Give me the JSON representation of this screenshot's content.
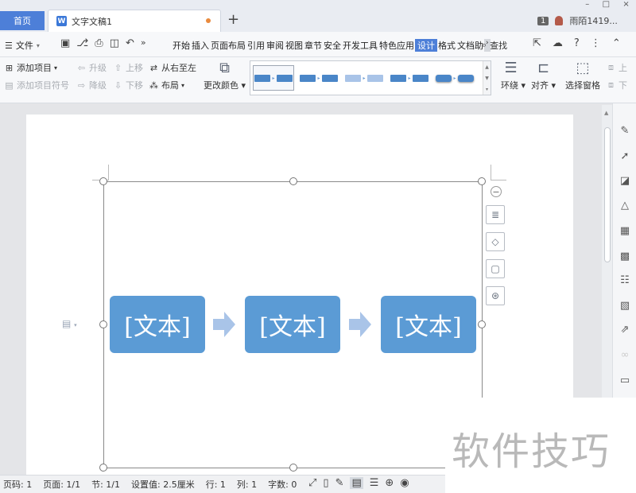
{
  "tabs": {
    "home_label": "首页",
    "doc_label": "文字文稿1",
    "doc_icon": "W",
    "new_tab": "+"
  },
  "window_controls": [
    "–",
    "□",
    "×"
  ],
  "user": {
    "badge": "1",
    "name": "雨陌1419..."
  },
  "menu": {
    "file_label": "文件",
    "ribbon_tabs": [
      "开始",
      "插入",
      "页面布局",
      "引用",
      "审阅",
      "视图",
      "章节",
      "安全",
      "开发工具",
      "特色应用",
      "设计",
      "格式",
      "文档助"
    ],
    "active_tab": "设计",
    "find_label": "查找",
    "help": "?"
  },
  "ribbon": {
    "add_item": "添加项目",
    "add_bullet": "添加项目符号",
    "promote": "升级",
    "demote": "降级",
    "move_up": "上移",
    "move_down": "下移",
    "right_to_left": "从右至左",
    "layout": "布局",
    "change_color": "更改颜色",
    "wrap": "环绕",
    "align": "对齐",
    "select_pane": "选择窗格",
    "up": "上",
    "down": "下"
  },
  "colors": {
    "accent": "#4d7fd8",
    "smartart_fill": "#5b9bd5",
    "arrow_fill": "#a9c4e8"
  },
  "smartart": {
    "items": [
      "[文本]",
      "[文本]",
      "[文本]"
    ]
  },
  "statusbar": {
    "page": "页码: 1",
    "pages": "页面: 1/1",
    "section": "节: 1/1",
    "position": "设置值: 2.5厘米",
    "row": "行: 1",
    "col": "列: 1",
    "words": "字数: 0"
  },
  "watermark": "软件技巧"
}
